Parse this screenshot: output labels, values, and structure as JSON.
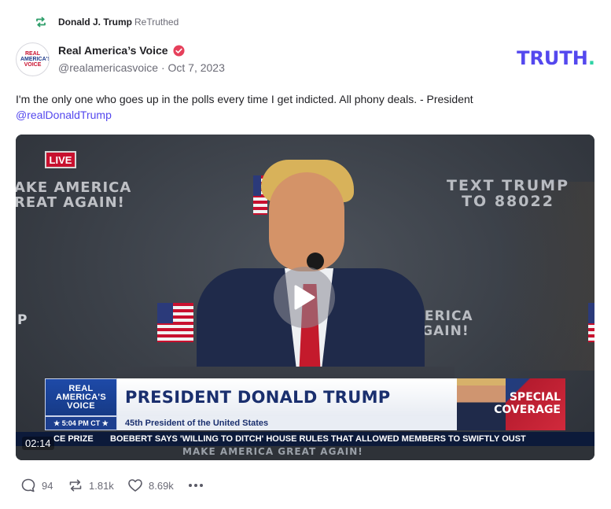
{
  "retruth": {
    "icon": "retruth-icon",
    "user": "Donald J. Trump",
    "label": "ReTruthed"
  },
  "post": {
    "author_name": "Real America’s Voice",
    "verified_icon": "verified-badge-icon",
    "handle": "@realamericasvoice",
    "separator": "·",
    "date": "Oct 7, 2023",
    "text": "I'm the only one who goes up in the polls every time I get indicted. All phony deals. - President",
    "mention": "@realDonaldTrump"
  },
  "avatar": {
    "line1": "REAL",
    "line2": "AMERICA'S",
    "line3": "VOICE"
  },
  "brand": {
    "text": "TRUTH",
    "dot": ".",
    "color": "#5448ee",
    "dot_color": "#2ed3a5"
  },
  "video": {
    "live_label": "LIVE",
    "bg_slogan_left": [
      "AKE AMERICA",
      "REAT AGAIN!"
    ],
    "bg_text_right": [
      "TEXT TRUMP",
      "TO 88022"
    ],
    "bg_slogan_mid": [
      "MERICA",
      "AGAIN!"
    ],
    "bg_p": "P",
    "play_icon": "play-icon",
    "lower_third": {
      "logo_lines": [
        "REAL",
        "AMERICA'S",
        "VOICE"
      ],
      "time": "★ 5:04 PM CT ★",
      "headline": "PRESIDENT DONALD TRUMP",
      "subheadline": "45th President of the United States",
      "special": [
        "SPECIAL",
        "COVERAGE"
      ]
    },
    "ticker_left": "CE PRIZE",
    "ticker_right": "BOEBERT SAYS 'WILLING TO DITCH' HOUSE RULES THAT ALLOWED MEMBERS TO SWIFTLY OUST",
    "under_ticker": "MAKE AMERICA GREAT AGAIN!",
    "duration": "02:14"
  },
  "actions": {
    "reply_count": "94",
    "retruth_count": "1.81k",
    "like_count": "8.69k",
    "more_icon": "more-options-icon"
  }
}
